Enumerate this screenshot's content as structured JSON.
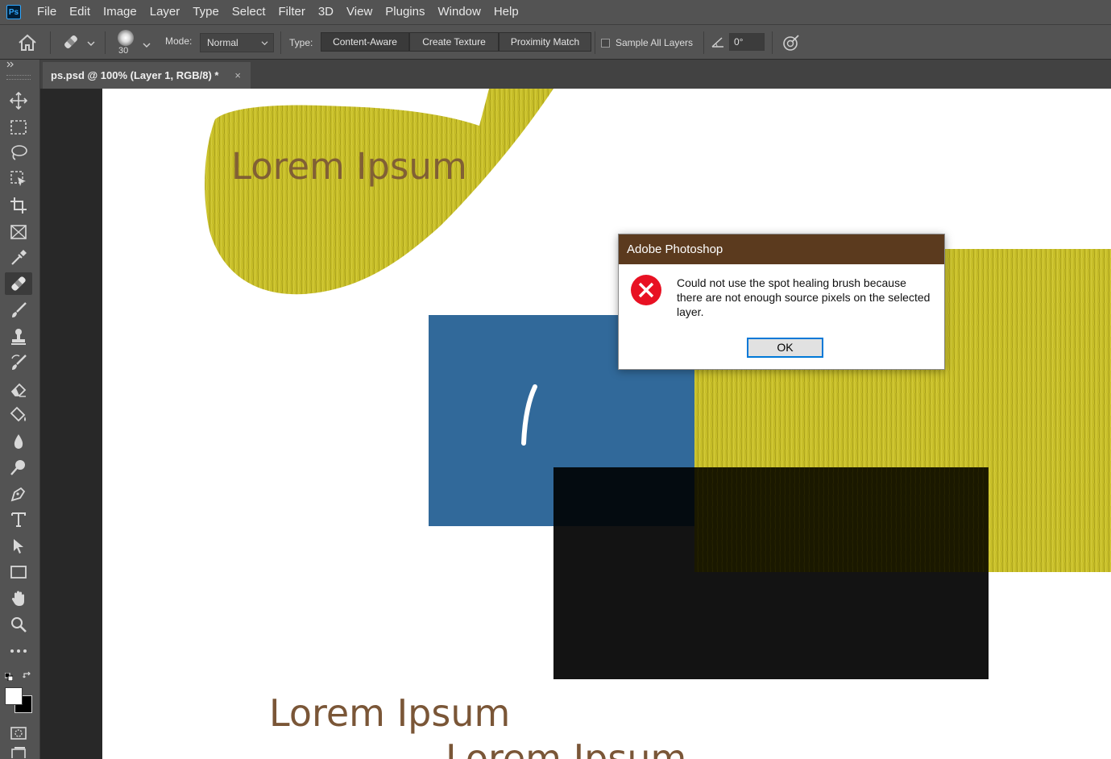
{
  "menubar": {
    "logo": "Ps",
    "items": [
      "File",
      "Edit",
      "Image",
      "Layer",
      "Type",
      "Select",
      "Filter",
      "3D",
      "View",
      "Plugins",
      "Window",
      "Help"
    ]
  },
  "options": {
    "brush_size": "30",
    "mode_label": "Mode:",
    "mode_value": "Normal",
    "type_label": "Type:",
    "type_buttons": [
      "Content-Aware",
      "Create Texture",
      "Proximity Match"
    ],
    "sample_all_layers": "Sample All Layers",
    "angle_value": "0°"
  },
  "document": {
    "tab_title": "ps.psd @ 100% (Layer 1, RGB/8) *",
    "close_glyph": "×",
    "texts": [
      "Lorem Ipsum",
      "Lorem Ipsum",
      "Lorem Ipsum"
    ]
  },
  "dialog": {
    "title": "Adobe Photoshop",
    "message": "Could not use the spot healing brush because there are not enough source pixels on the selected layer.",
    "ok_label": "OK"
  },
  "colors": {
    "menubar_bg": "#535353",
    "dialog_title_bg": "#5b3a1e",
    "olive_texture": "#c9c02a",
    "blue_block": "#31699a",
    "dark_block": "#131313",
    "text_brown": "#7a5637",
    "error_red": "#e81123"
  },
  "icons": {
    "tools": [
      "move",
      "marquee",
      "lasso",
      "object-select",
      "crop",
      "frame",
      "eyedropper",
      "spot-healing",
      "brush",
      "clone-stamp",
      "history-brush",
      "eraser",
      "paint-bucket",
      "blur",
      "dodge",
      "pen",
      "type",
      "path-select",
      "rectangle",
      "hand",
      "zoom",
      "more",
      "default-colors",
      "foreground-background",
      "quick-mask",
      "screen-mode"
    ]
  }
}
